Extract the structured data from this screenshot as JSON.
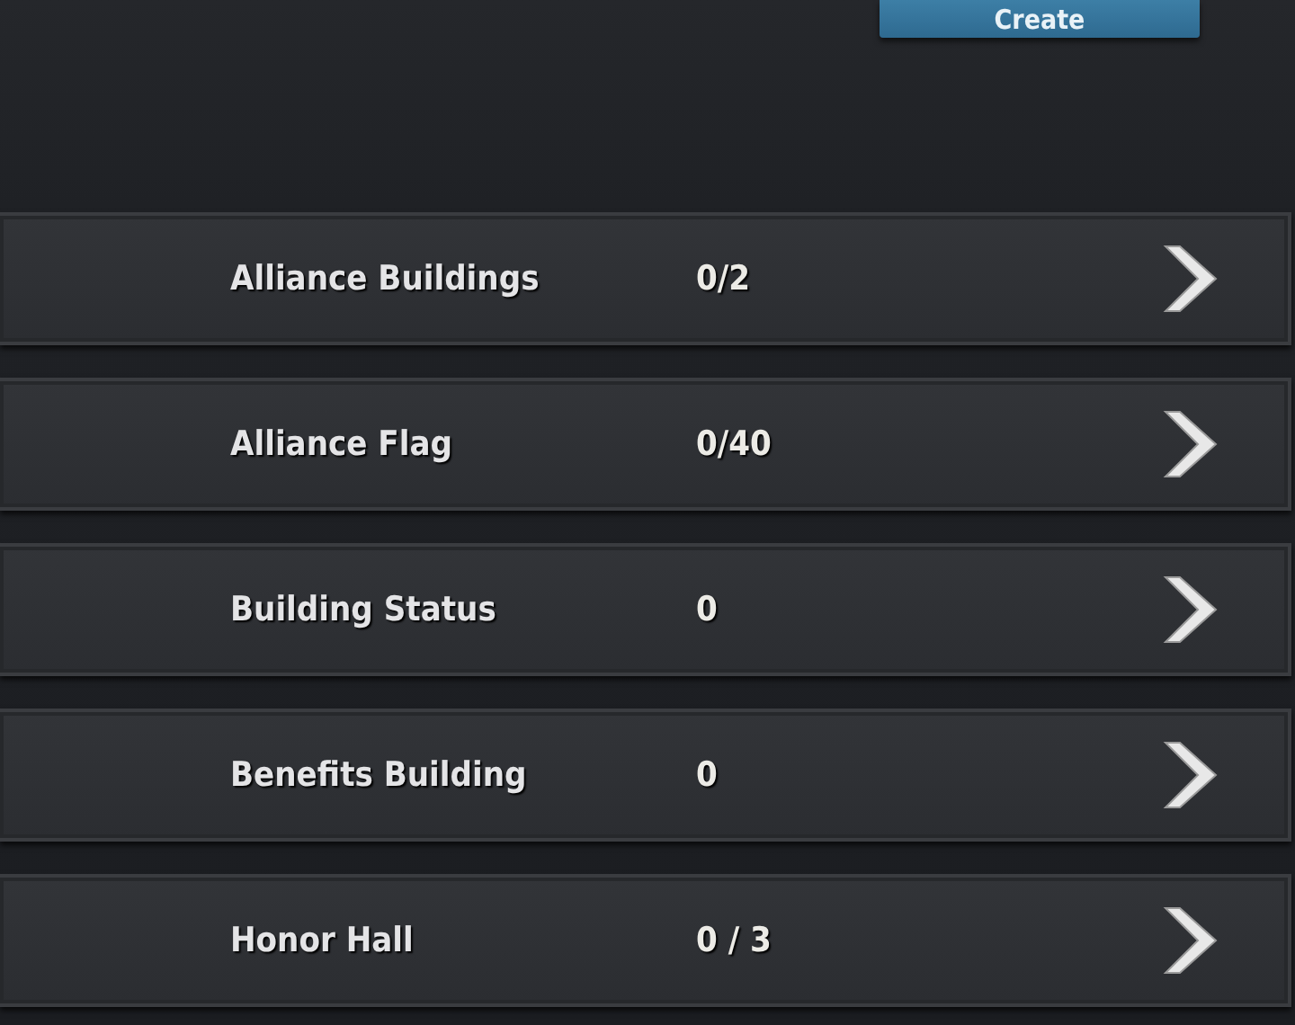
{
  "create_button": {
    "label": "Create"
  },
  "rows": [
    {
      "label": "Alliance Buildings",
      "value": "0/2"
    },
    {
      "label": "Alliance Flag",
      "value": "0/40"
    },
    {
      "label": "Building Status",
      "value": "0"
    },
    {
      "label": "Benefits Building",
      "value": "0"
    },
    {
      "label": "Honor Hall",
      "value": "0 / 3"
    }
  ]
}
